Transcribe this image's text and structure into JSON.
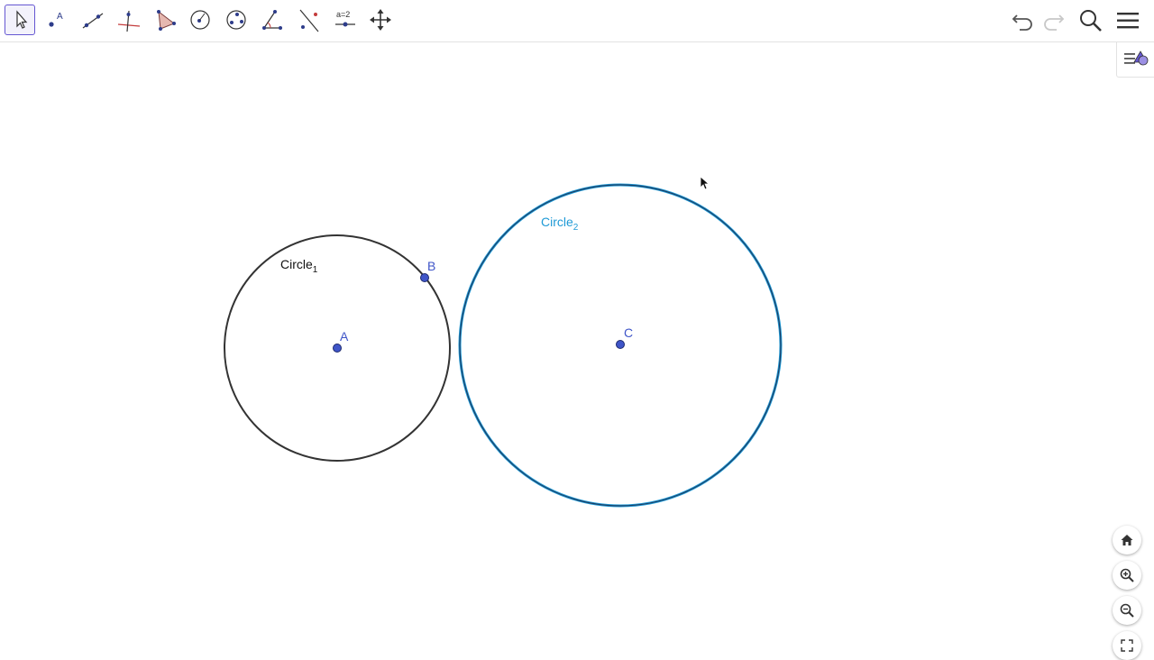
{
  "toolbar": {
    "tools": [
      {
        "name": "move-tool"
      },
      {
        "name": "point-tool",
        "glyph": "A"
      },
      {
        "name": "segment-tool"
      },
      {
        "name": "perpendicular-line-tool"
      },
      {
        "name": "polygon-tool"
      },
      {
        "name": "circle-center-point-tool"
      },
      {
        "name": "circle-three-points-tool"
      },
      {
        "name": "angle-tool"
      },
      {
        "name": "reflect-tool"
      },
      {
        "name": "slider-tool",
        "glyph": "a=2"
      },
      {
        "name": "move-graphics-view-tool"
      }
    ],
    "active_tool": "move-tool"
  },
  "header_actions": {
    "icons": [
      "undo-icon",
      "redo-icon",
      "search-icon",
      "menu-icon"
    ]
  },
  "canvas": {
    "circle1": {
      "label": "Circle",
      "subscript": "1",
      "color": "#333333"
    },
    "circle2": {
      "label": "Circle",
      "subscript": "2",
      "color": "#1f9ad6"
    },
    "points": {
      "A": "A",
      "B": "B",
      "C": "C",
      "color": "#3f55c8"
    }
  },
  "zoom_controls": {
    "icons": [
      "home-icon",
      "zoom-in-icon",
      "zoom-out-icon",
      "fullscreen-icon"
    ]
  },
  "colors": {
    "accent": "#6557d2",
    "point": "#3f55c8",
    "circle2": "#1f9ad6"
  }
}
